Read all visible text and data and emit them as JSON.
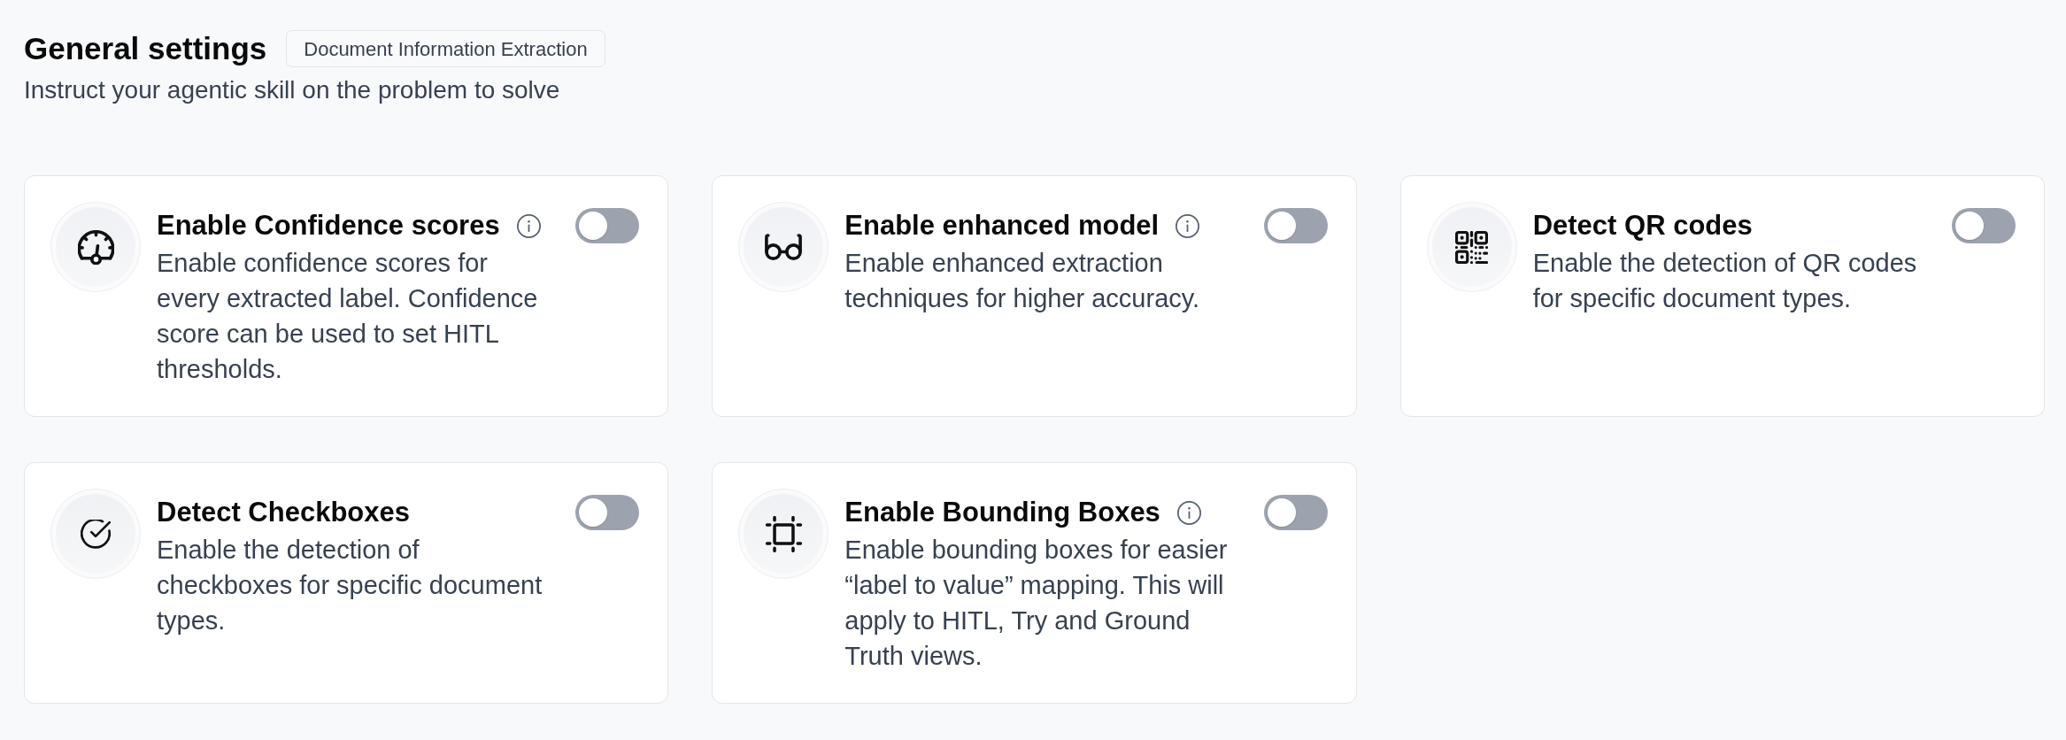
{
  "header": {
    "title": "General settings",
    "badge": "Document Information Extraction",
    "subtitle": "Instruct your agentic skill on the problem to solve"
  },
  "cards": [
    {
      "title": "Enable Confidence scores",
      "info": true,
      "description": "Enable confidence scores for every extracted label. Confidence score can be used to set HITL thresholds.",
      "on": false
    },
    {
      "title": "Enable enhanced model",
      "info": true,
      "description": "Enable enhanced extraction techniques for higher accuracy.",
      "on": false
    },
    {
      "title": "Detect QR codes",
      "info": false,
      "description": "Enable the detection of QR codes for specific document types.",
      "on": false
    },
    {
      "title": "Detect Checkboxes",
      "info": false,
      "description": "Enable the detection of checkboxes for specific document types.",
      "on": false
    },
    {
      "title": "Enable Bounding Boxes",
      "info": true,
      "description": "Enable bounding boxes for easier “label to value” mapping. This will apply to HITL, Try and Ground Truth views.",
      "on": false
    }
  ]
}
